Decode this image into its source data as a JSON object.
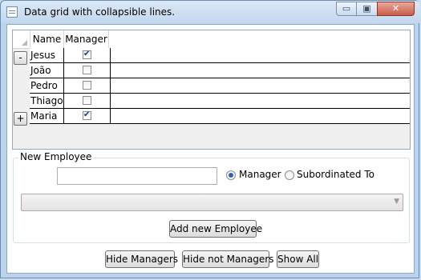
{
  "window": {
    "title": "Data grid with collapsible lines.",
    "controls": {
      "minimize": "▭",
      "maximize": "▣",
      "close": "✕"
    }
  },
  "grid": {
    "columns": [
      "Name",
      "Manager"
    ],
    "rows": [
      {
        "name": "Jesus",
        "manager": true,
        "expander": "-"
      },
      {
        "name": "João",
        "manager": false,
        "expander": ""
      },
      {
        "name": "Pedro",
        "manager": false,
        "expander": ""
      },
      {
        "name": "Thiago",
        "manager": false,
        "expander": ""
      },
      {
        "name": "Maria",
        "manager": true,
        "expander": "+"
      }
    ]
  },
  "new_employee": {
    "title": "New Employee",
    "name_value": "",
    "radio_manager": "Manager",
    "radio_subordinated": "Subordinated To",
    "selected_radio": "manager",
    "combo_value": "",
    "combo_arrow": "▼",
    "add_button": "Add new Employee"
  },
  "footer": {
    "hide_managers": "Hide Managers",
    "hide_not_managers": "Hide not Managers",
    "show_all": "Show All"
  }
}
